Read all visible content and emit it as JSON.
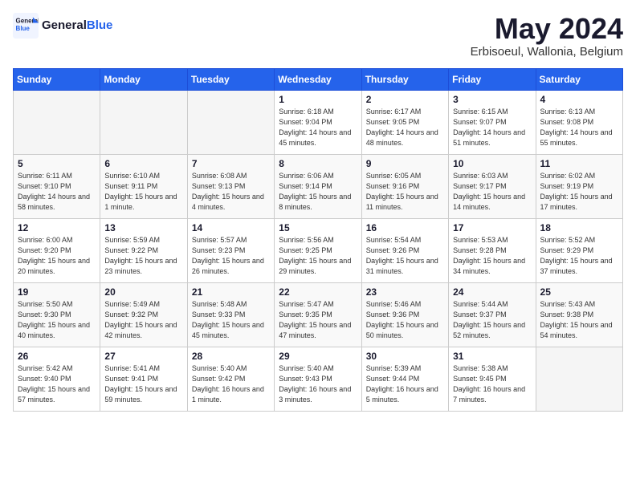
{
  "header": {
    "logo_general": "General",
    "logo_blue": "Blue",
    "title": "May 2024",
    "subtitle": "Erbisoeul, Wallonia, Belgium"
  },
  "days_of_week": [
    "Sunday",
    "Monday",
    "Tuesday",
    "Wednesday",
    "Thursday",
    "Friday",
    "Saturday"
  ],
  "weeks": [
    [
      {
        "num": "",
        "sunrise": "",
        "sunset": "",
        "daylight": "",
        "empty": true
      },
      {
        "num": "",
        "sunrise": "",
        "sunset": "",
        "daylight": "",
        "empty": true
      },
      {
        "num": "",
        "sunrise": "",
        "sunset": "",
        "daylight": "",
        "empty": true
      },
      {
        "num": "1",
        "sunrise": "Sunrise: 6:18 AM",
        "sunset": "Sunset: 9:04 PM",
        "daylight": "Daylight: 14 hours and 45 minutes.",
        "empty": false
      },
      {
        "num": "2",
        "sunrise": "Sunrise: 6:17 AM",
        "sunset": "Sunset: 9:05 PM",
        "daylight": "Daylight: 14 hours and 48 minutes.",
        "empty": false
      },
      {
        "num": "3",
        "sunrise": "Sunrise: 6:15 AM",
        "sunset": "Sunset: 9:07 PM",
        "daylight": "Daylight: 14 hours and 51 minutes.",
        "empty": false
      },
      {
        "num": "4",
        "sunrise": "Sunrise: 6:13 AM",
        "sunset": "Sunset: 9:08 PM",
        "daylight": "Daylight: 14 hours and 55 minutes.",
        "empty": false
      }
    ],
    [
      {
        "num": "5",
        "sunrise": "Sunrise: 6:11 AM",
        "sunset": "Sunset: 9:10 PM",
        "daylight": "Daylight: 14 hours and 58 minutes.",
        "empty": false
      },
      {
        "num": "6",
        "sunrise": "Sunrise: 6:10 AM",
        "sunset": "Sunset: 9:11 PM",
        "daylight": "Daylight: 15 hours and 1 minute.",
        "empty": false
      },
      {
        "num": "7",
        "sunrise": "Sunrise: 6:08 AM",
        "sunset": "Sunset: 9:13 PM",
        "daylight": "Daylight: 15 hours and 4 minutes.",
        "empty": false
      },
      {
        "num": "8",
        "sunrise": "Sunrise: 6:06 AM",
        "sunset": "Sunset: 9:14 PM",
        "daylight": "Daylight: 15 hours and 8 minutes.",
        "empty": false
      },
      {
        "num": "9",
        "sunrise": "Sunrise: 6:05 AM",
        "sunset": "Sunset: 9:16 PM",
        "daylight": "Daylight: 15 hours and 11 minutes.",
        "empty": false
      },
      {
        "num": "10",
        "sunrise": "Sunrise: 6:03 AM",
        "sunset": "Sunset: 9:17 PM",
        "daylight": "Daylight: 15 hours and 14 minutes.",
        "empty": false
      },
      {
        "num": "11",
        "sunrise": "Sunrise: 6:02 AM",
        "sunset": "Sunset: 9:19 PM",
        "daylight": "Daylight: 15 hours and 17 minutes.",
        "empty": false
      }
    ],
    [
      {
        "num": "12",
        "sunrise": "Sunrise: 6:00 AM",
        "sunset": "Sunset: 9:20 PM",
        "daylight": "Daylight: 15 hours and 20 minutes.",
        "empty": false
      },
      {
        "num": "13",
        "sunrise": "Sunrise: 5:59 AM",
        "sunset": "Sunset: 9:22 PM",
        "daylight": "Daylight: 15 hours and 23 minutes.",
        "empty": false
      },
      {
        "num": "14",
        "sunrise": "Sunrise: 5:57 AM",
        "sunset": "Sunset: 9:23 PM",
        "daylight": "Daylight: 15 hours and 26 minutes.",
        "empty": false
      },
      {
        "num": "15",
        "sunrise": "Sunrise: 5:56 AM",
        "sunset": "Sunset: 9:25 PM",
        "daylight": "Daylight: 15 hours and 29 minutes.",
        "empty": false
      },
      {
        "num": "16",
        "sunrise": "Sunrise: 5:54 AM",
        "sunset": "Sunset: 9:26 PM",
        "daylight": "Daylight: 15 hours and 31 minutes.",
        "empty": false
      },
      {
        "num": "17",
        "sunrise": "Sunrise: 5:53 AM",
        "sunset": "Sunset: 9:28 PM",
        "daylight": "Daylight: 15 hours and 34 minutes.",
        "empty": false
      },
      {
        "num": "18",
        "sunrise": "Sunrise: 5:52 AM",
        "sunset": "Sunset: 9:29 PM",
        "daylight": "Daylight: 15 hours and 37 minutes.",
        "empty": false
      }
    ],
    [
      {
        "num": "19",
        "sunrise": "Sunrise: 5:50 AM",
        "sunset": "Sunset: 9:30 PM",
        "daylight": "Daylight: 15 hours and 40 minutes.",
        "empty": false
      },
      {
        "num": "20",
        "sunrise": "Sunrise: 5:49 AM",
        "sunset": "Sunset: 9:32 PM",
        "daylight": "Daylight: 15 hours and 42 minutes.",
        "empty": false
      },
      {
        "num": "21",
        "sunrise": "Sunrise: 5:48 AM",
        "sunset": "Sunset: 9:33 PM",
        "daylight": "Daylight: 15 hours and 45 minutes.",
        "empty": false
      },
      {
        "num": "22",
        "sunrise": "Sunrise: 5:47 AM",
        "sunset": "Sunset: 9:35 PM",
        "daylight": "Daylight: 15 hours and 47 minutes.",
        "empty": false
      },
      {
        "num": "23",
        "sunrise": "Sunrise: 5:46 AM",
        "sunset": "Sunset: 9:36 PM",
        "daylight": "Daylight: 15 hours and 50 minutes.",
        "empty": false
      },
      {
        "num": "24",
        "sunrise": "Sunrise: 5:44 AM",
        "sunset": "Sunset: 9:37 PM",
        "daylight": "Daylight: 15 hours and 52 minutes.",
        "empty": false
      },
      {
        "num": "25",
        "sunrise": "Sunrise: 5:43 AM",
        "sunset": "Sunset: 9:38 PM",
        "daylight": "Daylight: 15 hours and 54 minutes.",
        "empty": false
      }
    ],
    [
      {
        "num": "26",
        "sunrise": "Sunrise: 5:42 AM",
        "sunset": "Sunset: 9:40 PM",
        "daylight": "Daylight: 15 hours and 57 minutes.",
        "empty": false
      },
      {
        "num": "27",
        "sunrise": "Sunrise: 5:41 AM",
        "sunset": "Sunset: 9:41 PM",
        "daylight": "Daylight: 15 hours and 59 minutes.",
        "empty": false
      },
      {
        "num": "28",
        "sunrise": "Sunrise: 5:40 AM",
        "sunset": "Sunset: 9:42 PM",
        "daylight": "Daylight: 16 hours and 1 minute.",
        "empty": false
      },
      {
        "num": "29",
        "sunrise": "Sunrise: 5:40 AM",
        "sunset": "Sunset: 9:43 PM",
        "daylight": "Daylight: 16 hours and 3 minutes.",
        "empty": false
      },
      {
        "num": "30",
        "sunrise": "Sunrise: 5:39 AM",
        "sunset": "Sunset: 9:44 PM",
        "daylight": "Daylight: 16 hours and 5 minutes.",
        "empty": false
      },
      {
        "num": "31",
        "sunrise": "Sunrise: 5:38 AM",
        "sunset": "Sunset: 9:45 PM",
        "daylight": "Daylight: 16 hours and 7 minutes.",
        "empty": false
      },
      {
        "num": "",
        "sunrise": "",
        "sunset": "",
        "daylight": "",
        "empty": true
      }
    ]
  ]
}
